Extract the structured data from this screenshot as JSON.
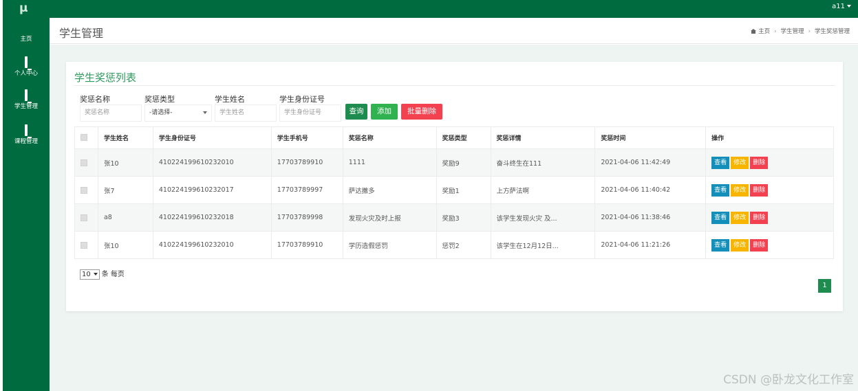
{
  "app": {
    "logo": "μ",
    "user": "a11"
  },
  "sidebar": {
    "items": [
      {
        "icon": "dashboard-icon",
        "label": "主页"
      },
      {
        "icon": "monitor-icon",
        "label": "个人中心"
      },
      {
        "icon": "monitor-icon",
        "label": "学生管理"
      },
      {
        "icon": "monitor-icon",
        "label": "课程管理"
      }
    ]
  },
  "header": {
    "title": "学生管理",
    "breadcrumb": [
      "主页",
      "学生管理",
      "学生奖惩管理"
    ]
  },
  "card": {
    "title": "学生奖惩列表"
  },
  "filters": {
    "award_name": {
      "label": "奖惩名称",
      "placeholder": "奖惩名称"
    },
    "award_type": {
      "label": "奖惩类型",
      "value": "-请选择-"
    },
    "student_name": {
      "label": "学生姓名",
      "placeholder": "学生姓名"
    },
    "id_card": {
      "label": "学生身份证号",
      "placeholder": "学生身份证号"
    }
  },
  "buttons": {
    "query": "查询",
    "add": "添加",
    "batch_delete": "批量删除"
  },
  "table": {
    "headers": [
      "学生姓名",
      "学生身份证号",
      "学生手机号",
      "奖惩名称",
      "奖惩类型",
      "奖惩详情",
      "奖惩时间",
      "操作"
    ],
    "rows": [
      {
        "name": "张10",
        "id": "410224199610232010",
        "phone": "17703789910",
        "award": "1111",
        "type": "奖励9",
        "detail": "奋斗终生在111",
        "time": "2021-04-06 11:42:49"
      },
      {
        "name": "张7",
        "id": "410224199610232017",
        "phone": "17703789997",
        "award": "萨达撒多",
        "type": "奖励1",
        "detail": "上方萨法啊",
        "time": "2021-04-06 11:40:42"
      },
      {
        "name": "a8",
        "id": "410224199610232018",
        "phone": "17703789998",
        "award": "发现火灾及时上报",
        "type": "奖励3",
        "detail": "该学生发现火灾 及...",
        "time": "2021-04-06 11:38:46"
      },
      {
        "name": "张10",
        "id": "410224199610232010",
        "phone": "17703789910",
        "award": "学历造假惩罚",
        "type": "惩罚2",
        "detail": "该学生在12月12日...",
        "time": "2021-04-06 11:21:26"
      }
    ],
    "actions": {
      "view": "查看",
      "edit": "修改",
      "delete": "删除"
    }
  },
  "pagination": {
    "page_size": "10",
    "page_size_suffix": "条 每页",
    "current_page": "1"
  },
  "watermark": "CSDN @卧龙文化工作室",
  "colors": {
    "primary": "#006b3f",
    "accent": "#2e9a5c",
    "danger": "#f34150",
    "warning": "#f7b500",
    "info": "#138fba"
  }
}
